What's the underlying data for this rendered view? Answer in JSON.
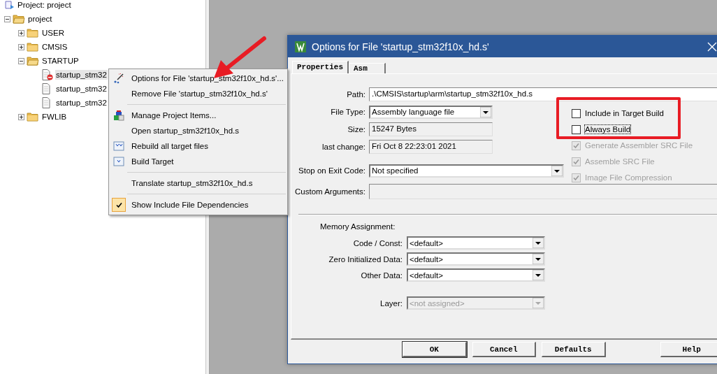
{
  "project_tree": {
    "title": "Project: project",
    "root": {
      "label": "project",
      "expanded": true,
      "children": [
        {
          "label": "USER",
          "expanded": false
        },
        {
          "label": "CMSIS",
          "expanded": false
        },
        {
          "label": "STARTUP",
          "expanded": true,
          "children": [
            {
              "label": "startup_stm32",
              "selected": true,
              "excluded": true
            },
            {
              "label": "startup_stm32",
              "selected": false,
              "excluded": false
            },
            {
              "label": "startup_stm32",
              "selected": false,
              "excluded": false
            }
          ]
        },
        {
          "label": "FWLIB",
          "expanded": false
        }
      ]
    }
  },
  "context_menu": {
    "items": [
      {
        "kind": "item",
        "label": "Options for File 'startup_stm32f10x_hd.s'...",
        "checked": false
      },
      {
        "kind": "item",
        "label": "Remove File 'startup_stm32f10x_hd.s'",
        "checked": false
      },
      {
        "kind": "separator"
      },
      {
        "kind": "item",
        "label": "Manage Project Items...",
        "checked": false
      },
      {
        "kind": "item",
        "label": "Open startup_stm32f10x_hd.s",
        "checked": false
      },
      {
        "kind": "item",
        "label": "Rebuild all target files",
        "checked": false
      },
      {
        "kind": "item",
        "label": "Build Target",
        "checked": false
      },
      {
        "kind": "separator"
      },
      {
        "kind": "item",
        "label": "Translate startup_stm32f10x_hd.s",
        "checked": false
      },
      {
        "kind": "separator"
      },
      {
        "kind": "item",
        "label": "Show Include File Dependencies",
        "checked": true
      }
    ]
  },
  "dialog": {
    "title": "Options for File 'startup_stm32f10x_hd.s'",
    "tabs": [
      {
        "label": "Properties",
        "selected": true
      },
      {
        "label": "Asm",
        "selected": false
      }
    ],
    "path": {
      "label": "Path:",
      "value": ".\\CMSIS\\startup\\arm\\startup_stm32f10x_hd.s"
    },
    "info": [
      {
        "kind": "select",
        "label": "File Type:",
        "value": "Assembly language file"
      },
      {
        "kind": "readonly",
        "label": "Size:",
        "value": "15247 Bytes"
      },
      {
        "kind": "readonly",
        "label": "last change:",
        "value": "Fri Oct  8 22:23:01 2021"
      }
    ],
    "stop_on_exit": {
      "label": "Stop on Exit Code:",
      "value": "Not specified"
    },
    "custom_arguments": {
      "label": "Custom Arguments:"
    },
    "checkboxes": [
      {
        "label": "Include in Target Build",
        "checked": false,
        "disabled": false,
        "focused": false
      },
      {
        "label": "Always Build",
        "checked": false,
        "disabled": false,
        "focused": true
      },
      {
        "label": "Generate Assembler SRC File",
        "checked": true,
        "disabled": true,
        "focused": false
      },
      {
        "label": "Assemble SRC File",
        "checked": true,
        "disabled": true,
        "focused": false
      },
      {
        "label": "Image File Compression",
        "checked": true,
        "disabled": true,
        "focused": false
      }
    ],
    "memory": {
      "title": "Memory Assignment:",
      "selects": [
        {
          "label": "Code / Const:",
          "value": "<default>",
          "disabled": false
        },
        {
          "label": "Zero Initialized Data:",
          "value": "<default>",
          "disabled": false
        },
        {
          "label": "Other Data:",
          "value": "<default>",
          "disabled": false
        },
        {
          "label": "Layer:",
          "value": "<not assigned>",
          "disabled": true
        }
      ]
    },
    "buttons": [
      {
        "label": "OK",
        "default": true
      },
      {
        "label": "Cancel",
        "default": false
      },
      {
        "label": "Defaults",
        "default": false
      },
      {
        "label": "Help",
        "default": false
      }
    ]
  }
}
